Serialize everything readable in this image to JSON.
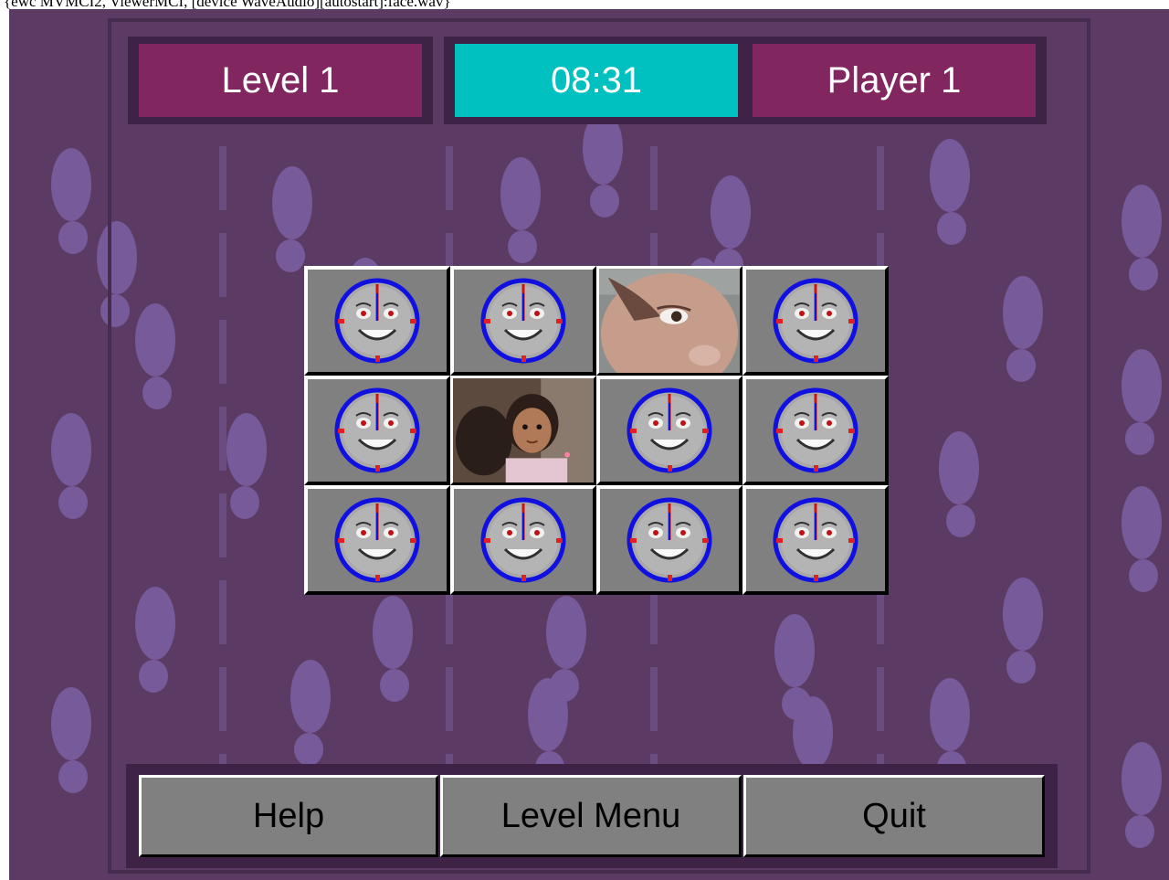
{
  "mci_command_text": "{ewc MVMCI2, ViewerMCI, [device WaveAudio][autostart]:face.wav}",
  "header": {
    "level": "Level 1",
    "timer": "08:31",
    "player": "Player 1"
  },
  "colors": {
    "board_bg": "#5b3b63",
    "footprint": "#775a99",
    "panel_maroon": "#82265f",
    "panel_cyan": "#00c0c0",
    "card_gray": "#808080",
    "clock_ring": "#1010e0"
  },
  "cards": [
    {
      "state": "face-down",
      "icon": "smiley-clock-icon"
    },
    {
      "state": "face-down",
      "icon": "smiley-clock-icon"
    },
    {
      "state": "face-up",
      "icon": "photo-close-up-face"
    },
    {
      "state": "face-down",
      "icon": "smiley-clock-icon"
    },
    {
      "state": "face-down",
      "icon": "smiley-clock-icon"
    },
    {
      "state": "face-up",
      "icon": "photo-girl-with-doll"
    },
    {
      "state": "face-down",
      "icon": "smiley-clock-icon"
    },
    {
      "state": "face-down",
      "icon": "smiley-clock-icon"
    },
    {
      "state": "face-down",
      "icon": "smiley-clock-icon"
    },
    {
      "state": "face-down",
      "icon": "smiley-clock-icon"
    },
    {
      "state": "face-down",
      "icon": "smiley-clock-icon"
    },
    {
      "state": "face-down",
      "icon": "smiley-clock-icon"
    }
  ],
  "buttons": {
    "help": "Help",
    "level_menu": "Level Menu",
    "quit": "Quit"
  }
}
